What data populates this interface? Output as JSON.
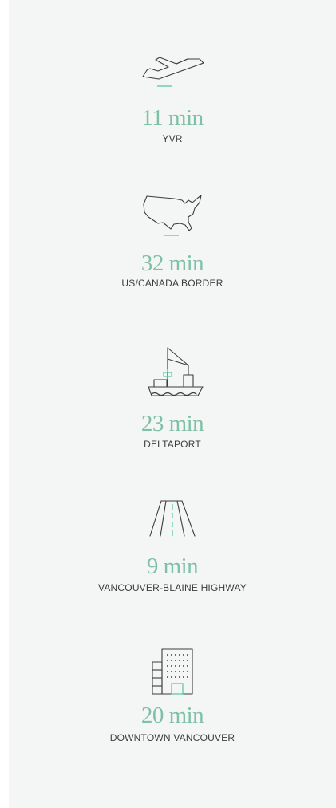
{
  "colors": {
    "background": "#f3f6f5",
    "accent": "#7fc0a7",
    "icon_stroke": "#3c3c3c",
    "icon_highlight": "#52c79b"
  },
  "items": [
    {
      "icon": "airplane-icon",
      "time": "11 min",
      "place": "YVR"
    },
    {
      "icon": "usa-map-icon",
      "time": "32 min",
      "place": "US/CANADA BORDER"
    },
    {
      "icon": "cargo-ship-crane-icon",
      "time": "23 min",
      "place": "DELTAPORT"
    },
    {
      "icon": "highway-road-icon",
      "time": "9 min",
      "place": "VANCOUVER-BLAINE HIGHWAY"
    },
    {
      "icon": "office-building-icon",
      "time": "20 min",
      "place": "DOWNTOWN VANCOUVER"
    }
  ]
}
